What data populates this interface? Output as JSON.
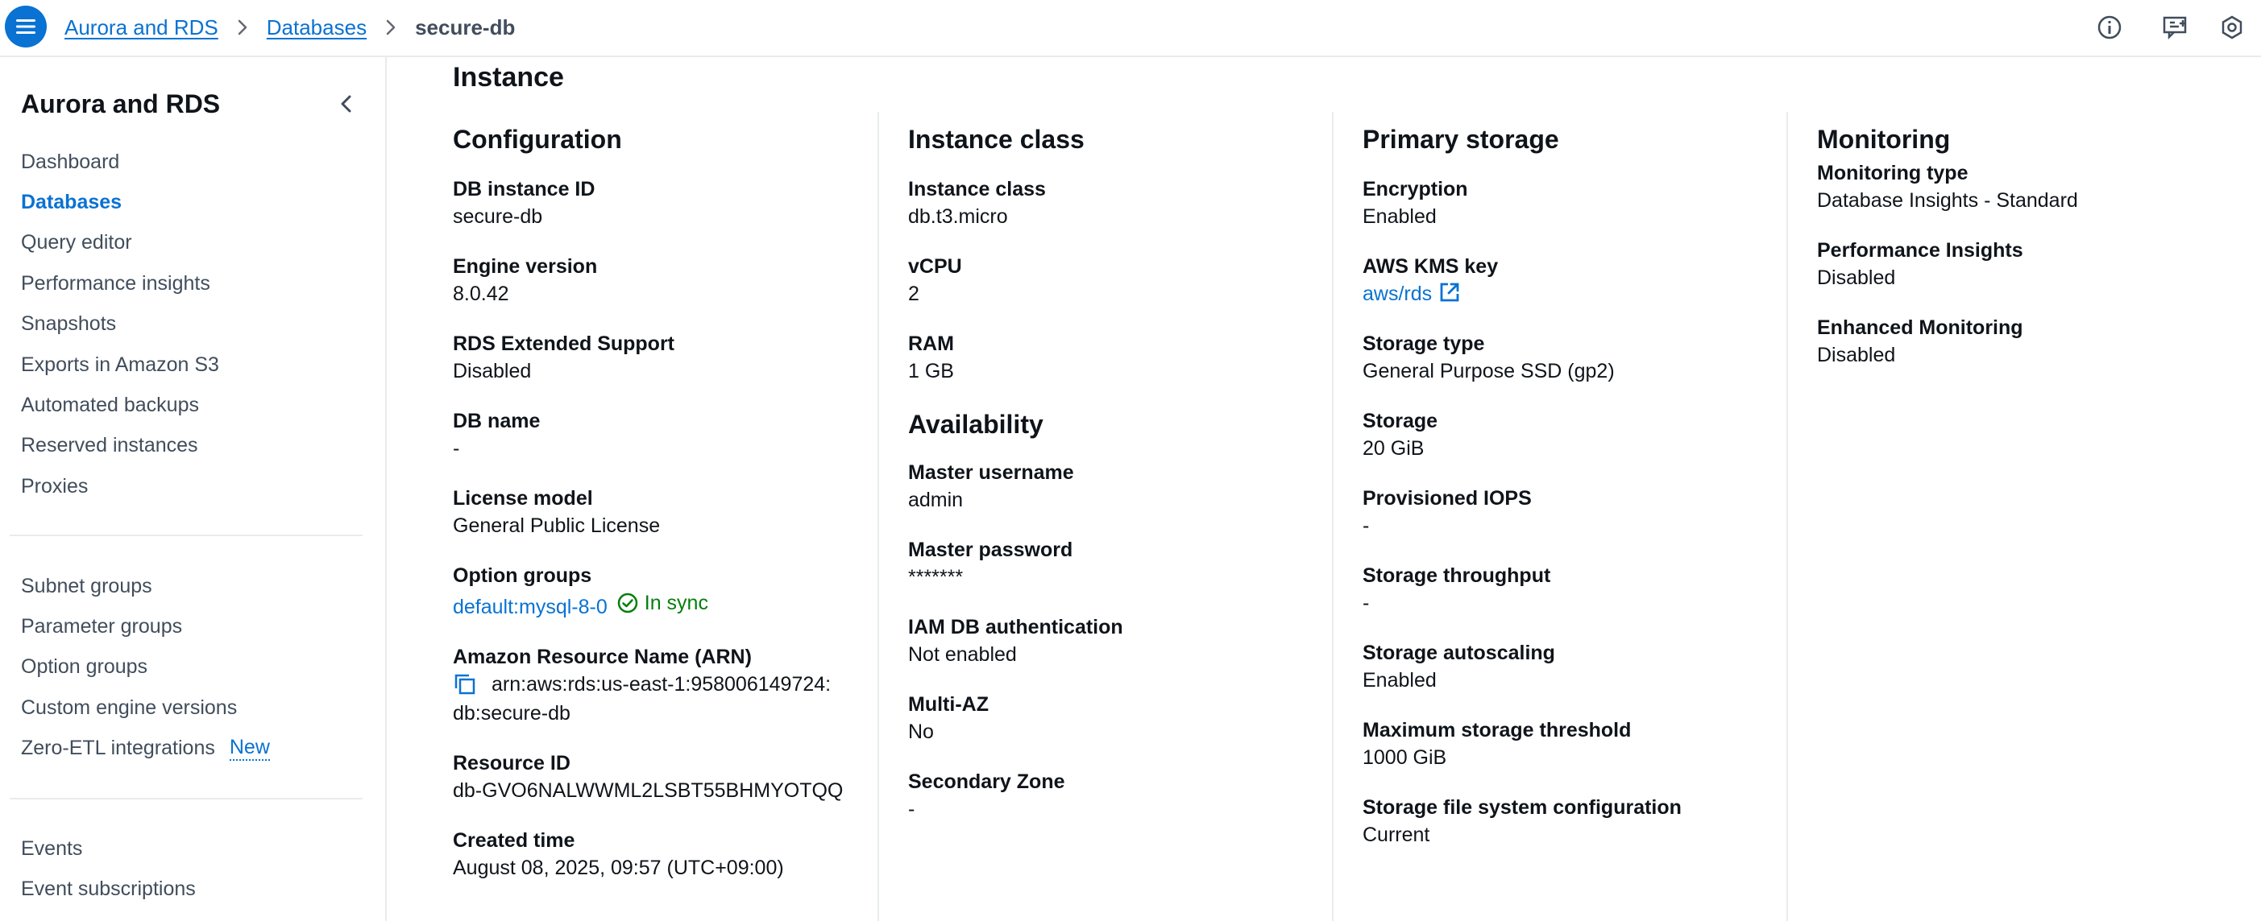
{
  "header": {
    "breadcrumbs": [
      "Aurora and RDS",
      "Databases"
    ],
    "current": "secure-db"
  },
  "sidebar": {
    "title": "Aurora and RDS",
    "group1": [
      {
        "label": "Dashboard"
      },
      {
        "label": "Databases",
        "active": true
      },
      {
        "label": "Query editor"
      },
      {
        "label": "Performance insights"
      },
      {
        "label": "Snapshots"
      },
      {
        "label": "Exports in Amazon S3"
      },
      {
        "label": "Automated backups"
      },
      {
        "label": "Reserved instances"
      },
      {
        "label": "Proxies"
      }
    ],
    "group2": [
      {
        "label": "Subnet groups"
      },
      {
        "label": "Parameter groups"
      },
      {
        "label": "Option groups"
      },
      {
        "label": "Custom engine versions"
      },
      {
        "label": "Zero-ETL integrations",
        "badge": "New"
      }
    ],
    "group3": [
      {
        "label": "Events"
      },
      {
        "label": "Event subscriptions"
      }
    ]
  },
  "main": {
    "section_title": "Instance",
    "configuration": {
      "title": "Configuration",
      "db_instance_id": {
        "label": "DB instance ID",
        "value": "secure-db"
      },
      "engine_version": {
        "label": "Engine version",
        "value": "8.0.42"
      },
      "extended_support": {
        "label": "RDS Extended Support",
        "value": "Disabled"
      },
      "db_name": {
        "label": "DB name",
        "value": "-"
      },
      "license_model": {
        "label": "License model",
        "value": "General Public License"
      },
      "option_groups": {
        "label": "Option groups",
        "value": "default:mysql-8-0",
        "status": "In sync"
      },
      "arn": {
        "label": "Amazon Resource Name (ARN)",
        "value_line1": "arn:aws:rds:us-east-1:958006149724:",
        "value_line2": "db:secure-db"
      },
      "resource_id": {
        "label": "Resource ID",
        "value": "db-GVO6NALWWML2LSBT55BHMYOTQQ"
      },
      "created_time": {
        "label": "Created time",
        "value": "August 08, 2025, 09:57 (UTC+09:00)"
      }
    },
    "instance_class": {
      "title": "Instance class",
      "instance_class": {
        "label": "Instance class",
        "value": "db.t3.micro"
      },
      "vcpu": {
        "label": "vCPU",
        "value": "2"
      },
      "ram": {
        "label": "RAM",
        "value": "1 GB"
      }
    },
    "availability": {
      "title": "Availability",
      "master_username": {
        "label": "Master username",
        "value": "admin"
      },
      "master_password": {
        "label": "Master password",
        "value": "*******"
      },
      "iam_auth": {
        "label": "IAM DB authentication",
        "value": "Not enabled"
      },
      "multi_az": {
        "label": "Multi-AZ",
        "value": "No"
      },
      "secondary_zone": {
        "label": "Secondary Zone",
        "value": "-"
      }
    },
    "primary_storage": {
      "title": "Primary storage",
      "encryption": {
        "label": "Encryption",
        "value": "Enabled"
      },
      "kms_key": {
        "label": "AWS KMS key",
        "value": "aws/rds"
      },
      "storage_type": {
        "label": "Storage type",
        "value": "General Purpose SSD (gp2)"
      },
      "storage": {
        "label": "Storage",
        "value": "20 GiB"
      },
      "iops": {
        "label": "Provisioned IOPS",
        "value": "-"
      },
      "throughput": {
        "label": "Storage throughput",
        "value": "-"
      },
      "autoscaling": {
        "label": "Storage autoscaling",
        "value": "Enabled"
      },
      "max_threshold": {
        "label": "Maximum storage threshold",
        "value": "1000 GiB"
      },
      "fs_config": {
        "label": "Storage file system configuration",
        "value": "Current"
      }
    },
    "monitoring": {
      "title": "Monitoring",
      "monitoring_type": {
        "label": "Monitoring type",
        "value": "Database Insights - Standard"
      },
      "performance_insights": {
        "label": "Performance Insights",
        "value": "Disabled"
      },
      "enhanced_monitoring": {
        "label": "Enhanced Monitoring",
        "value": "Disabled"
      }
    }
  },
  "icons": {
    "menu": "hamburger-menu-icon",
    "breadcrumb_sep": "chevron-right-icon",
    "info": "info-icon",
    "feedback": "feedback-icon",
    "settings": "settings-icon",
    "collapse": "chevron-left-icon",
    "copy": "copy-icon",
    "external": "external-link-icon",
    "status_ok": "check-circle-icon"
  },
  "colors": {
    "link": "#0972d3",
    "success": "#037f0c",
    "text": "#0f141a",
    "nav_text": "#414d5c",
    "divider": "#e9ebed"
  }
}
